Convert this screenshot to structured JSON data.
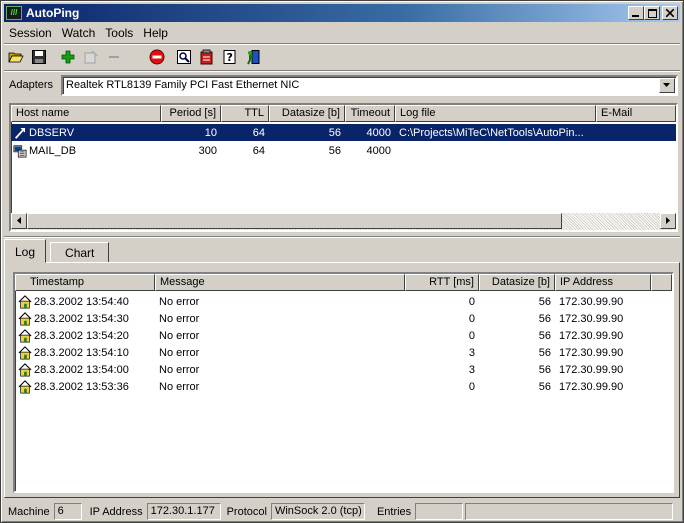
{
  "window": {
    "title": "AutoPing",
    "icon_text": "///"
  },
  "menu": [
    {
      "label": "Session"
    },
    {
      "label": "Watch"
    },
    {
      "label": "Tools"
    },
    {
      "label": "Help"
    }
  ],
  "toolbar": {
    "icons": [
      "open-folder-icon",
      "save-icon",
      "add-host-icon",
      "edit-host-icon",
      "remove-host-icon",
      "stop-icon",
      "find-icon",
      "properties-icon",
      "help-icon",
      "exit-icon"
    ]
  },
  "adapters": {
    "label": "Adapters",
    "selected": "Realtek RTL8139 Family PCI Fast Ethernet NIC"
  },
  "hosts": {
    "columns": [
      "Host name",
      "Period [s]",
      "TTL",
      "Datasize [b]",
      "Timeout",
      "Log file",
      "E-Mail"
    ],
    "rows": [
      {
        "host": "DBSERV",
        "period": "10",
        "ttl": "64",
        "datasize": "56",
        "timeout": "4000",
        "logfile": "C:\\Projects\\MiTeC\\NetTools\\AutoPin...",
        "email": "",
        "selected": true
      },
      {
        "host": "MAIL_DB",
        "period": "300",
        "ttl": "64",
        "datasize": "56",
        "timeout": "4000",
        "logfile": "",
        "email": "",
        "selected": false
      }
    ]
  },
  "tabs": [
    {
      "label": "Log",
      "active": true
    },
    {
      "label": "Chart",
      "active": false
    }
  ],
  "log": {
    "columns": [
      "Timestamp",
      "Message",
      "RTT [ms]",
      "Datasize [b]",
      "IP Address"
    ],
    "rows": [
      {
        "timestamp": "28.3.2002 13:54:40",
        "message": "No error",
        "rtt": "0",
        "datasize": "56",
        "ip": "172.30.99.90"
      },
      {
        "timestamp": "28.3.2002 13:54:30",
        "message": "No error",
        "rtt": "0",
        "datasize": "56",
        "ip": "172.30.99.90"
      },
      {
        "timestamp": "28.3.2002 13:54:20",
        "message": "No error",
        "rtt": "0",
        "datasize": "56",
        "ip": "172.30.99.90"
      },
      {
        "timestamp": "28.3.2002 13:54:10",
        "message": "No error",
        "rtt": "3",
        "datasize": "56",
        "ip": "172.30.99.90"
      },
      {
        "timestamp": "28.3.2002 13:54:00",
        "message": "No error",
        "rtt": "3",
        "datasize": "56",
        "ip": "172.30.99.90"
      },
      {
        "timestamp": "28.3.2002 13:53:36",
        "message": "No error",
        "rtt": "0",
        "datasize": "56",
        "ip": "172.30.99.90"
      }
    ]
  },
  "status": {
    "machine_label": "Machine",
    "machine": "6",
    "ip_label": "IP Address",
    "ip": "172.30.1.177",
    "protocol_label": "Protocol",
    "protocol": "WinSock 2.0 (tcp)",
    "entries_label": "Entries",
    "entries": ""
  },
  "colors": {
    "selection": "#0a246a",
    "titlebar": "#0a246a",
    "face": "#d4d0c8"
  }
}
